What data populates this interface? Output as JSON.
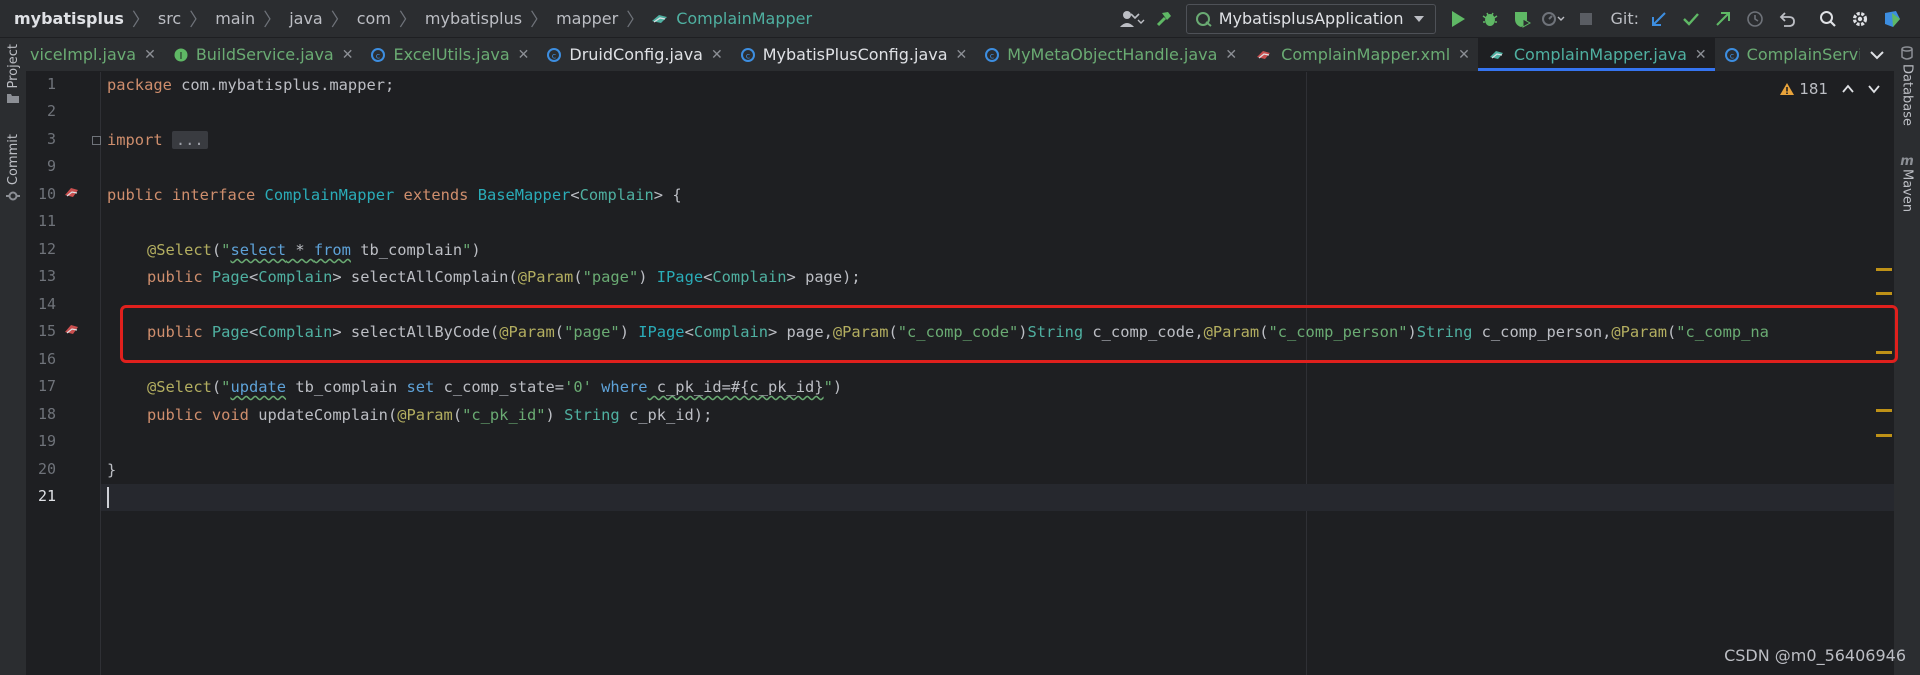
{
  "breadcrumb": {
    "project": "mybatisplus",
    "parts": [
      "src",
      "main",
      "java",
      "com",
      "mybatisplus",
      "mapper"
    ],
    "file": "ComplainMapper"
  },
  "toolbar": {
    "run_config": "MybatisplusApplication",
    "git_label": "Git:"
  },
  "tabs": [
    {
      "label": "viceImpl.java",
      "color": "green"
    },
    {
      "label": "BuildService.java",
      "color": "green"
    },
    {
      "label": "ExcelUtils.java",
      "color": "green"
    },
    {
      "label": "DruidConfig.java",
      "color": "white"
    },
    {
      "label": "MybatisPlusConfig.java",
      "color": "white"
    },
    {
      "label": "MyMetaObjectHandle.java",
      "color": "green"
    },
    {
      "label": "ComplainMapper.xml",
      "color": "green"
    },
    {
      "label": "ComplainMapper.java",
      "color": "teal",
      "active": true
    },
    {
      "label": "ComplainServiceImpl.java",
      "color": "green"
    }
  ],
  "side_tools": {
    "project": "Project",
    "commit": "Commit",
    "database": "Database",
    "maven": "Maven"
  },
  "inspection": {
    "warning_count": "181"
  },
  "line_numbers": [
    "1",
    "2",
    "3",
    "9",
    "10",
    "11",
    "12",
    "13",
    "14",
    "15",
    "16",
    "17",
    "18",
    "19",
    "20",
    "21"
  ],
  "code": {
    "l1_kw": "package",
    "l1_rest": " com.mybatisplus.mapper;",
    "l3_kw": "import",
    "l3_fold": "...",
    "l10_public": "public",
    "l10_interface": " interface ",
    "l10_name": "ComplainMapper",
    "l10_extends": " extends ",
    "l10_base": "BaseMapper",
    "l10_lt": "<",
    "l10_type": "Complain",
    "l10_end": "> {",
    "l12_ann": "@Select",
    "l12_open": "(",
    "l12_q1": "\"",
    "l12_select": "select",
    "l12_star": " * ",
    "l12_from": "from",
    "l12_table": " tb_complain",
    "l12_q2": "\"",
    "l12_close": ")",
    "l13_public": "public ",
    "l13_page": "Page",
    "l13_lt": "<",
    "l13_type": "Complain",
    "l13_gt": "> ",
    "l13_method": "selectAllComplain(",
    "l13_ann": "@Param",
    "l13_p1": "(",
    "l13_str": "\"page\"",
    "l13_p2": ") ",
    "l13_ipage": "IPage",
    "l13_lt2": "<",
    "l13_type2": "Complain",
    "l13_end": "> page);",
    "l15_public": "public ",
    "l15_page": "Page",
    "l15_lt": "<",
    "l15_type": "Complain",
    "l15_gt": "> ",
    "l15_method": "selectAllByCode(",
    "l15_ann1": "@Param",
    "l15_a": "(",
    "l15_s1": "\"page\"",
    "l15_b": ") ",
    "l15_ipage": "IPage",
    "l15_lt2": "<",
    "l15_type2": "Complain",
    "l15_c": "> page,",
    "l15_ann2": "@Param",
    "l15_d": "(",
    "l15_s2": "\"c_comp_code\"",
    "l15_e": ")",
    "l15_string1": "String",
    "l15_f": " c_comp_code,",
    "l15_ann3": "@Param",
    "l15_g": "(",
    "l15_s3": "\"c_comp_person\"",
    "l15_h": ")",
    "l15_string2": "String",
    "l15_i": " c_comp_person,",
    "l15_ann4": "@Param",
    "l15_j": "(",
    "l15_s4": "\"c_comp_na",
    "l17_ann": "@Select",
    "l17_open": "(",
    "l17_q1": "\"",
    "l17_update": "update",
    "l17_table": " tb_complain ",
    "l17_set": "set",
    "l17_col": " c_comp_state=",
    "l17_zero": "'0'",
    "l17_sp": " ",
    "l17_where": "where",
    "l17_cond": " c_pk_id=#{c_pk_id}",
    "l17_q2": "\"",
    "l17_close": ")",
    "l18_public": "public ",
    "l18_void": "void",
    "l18_method": " updateComplain(",
    "l18_ann": "@Param",
    "l18_a": "(",
    "l18_str": "\"c_pk_id\"",
    "l18_b": ") ",
    "l18_string": "String",
    "l18_end": " c_pk_id);",
    "l20": "}"
  },
  "watermark": "CSDN @m0_56406946",
  "colors": {
    "keyword": "#cf8e6d",
    "annotation": "#b3ae60",
    "string": "#6aab73",
    "type": "#4fb0a1",
    "highlight_border": "#e0201d"
  }
}
